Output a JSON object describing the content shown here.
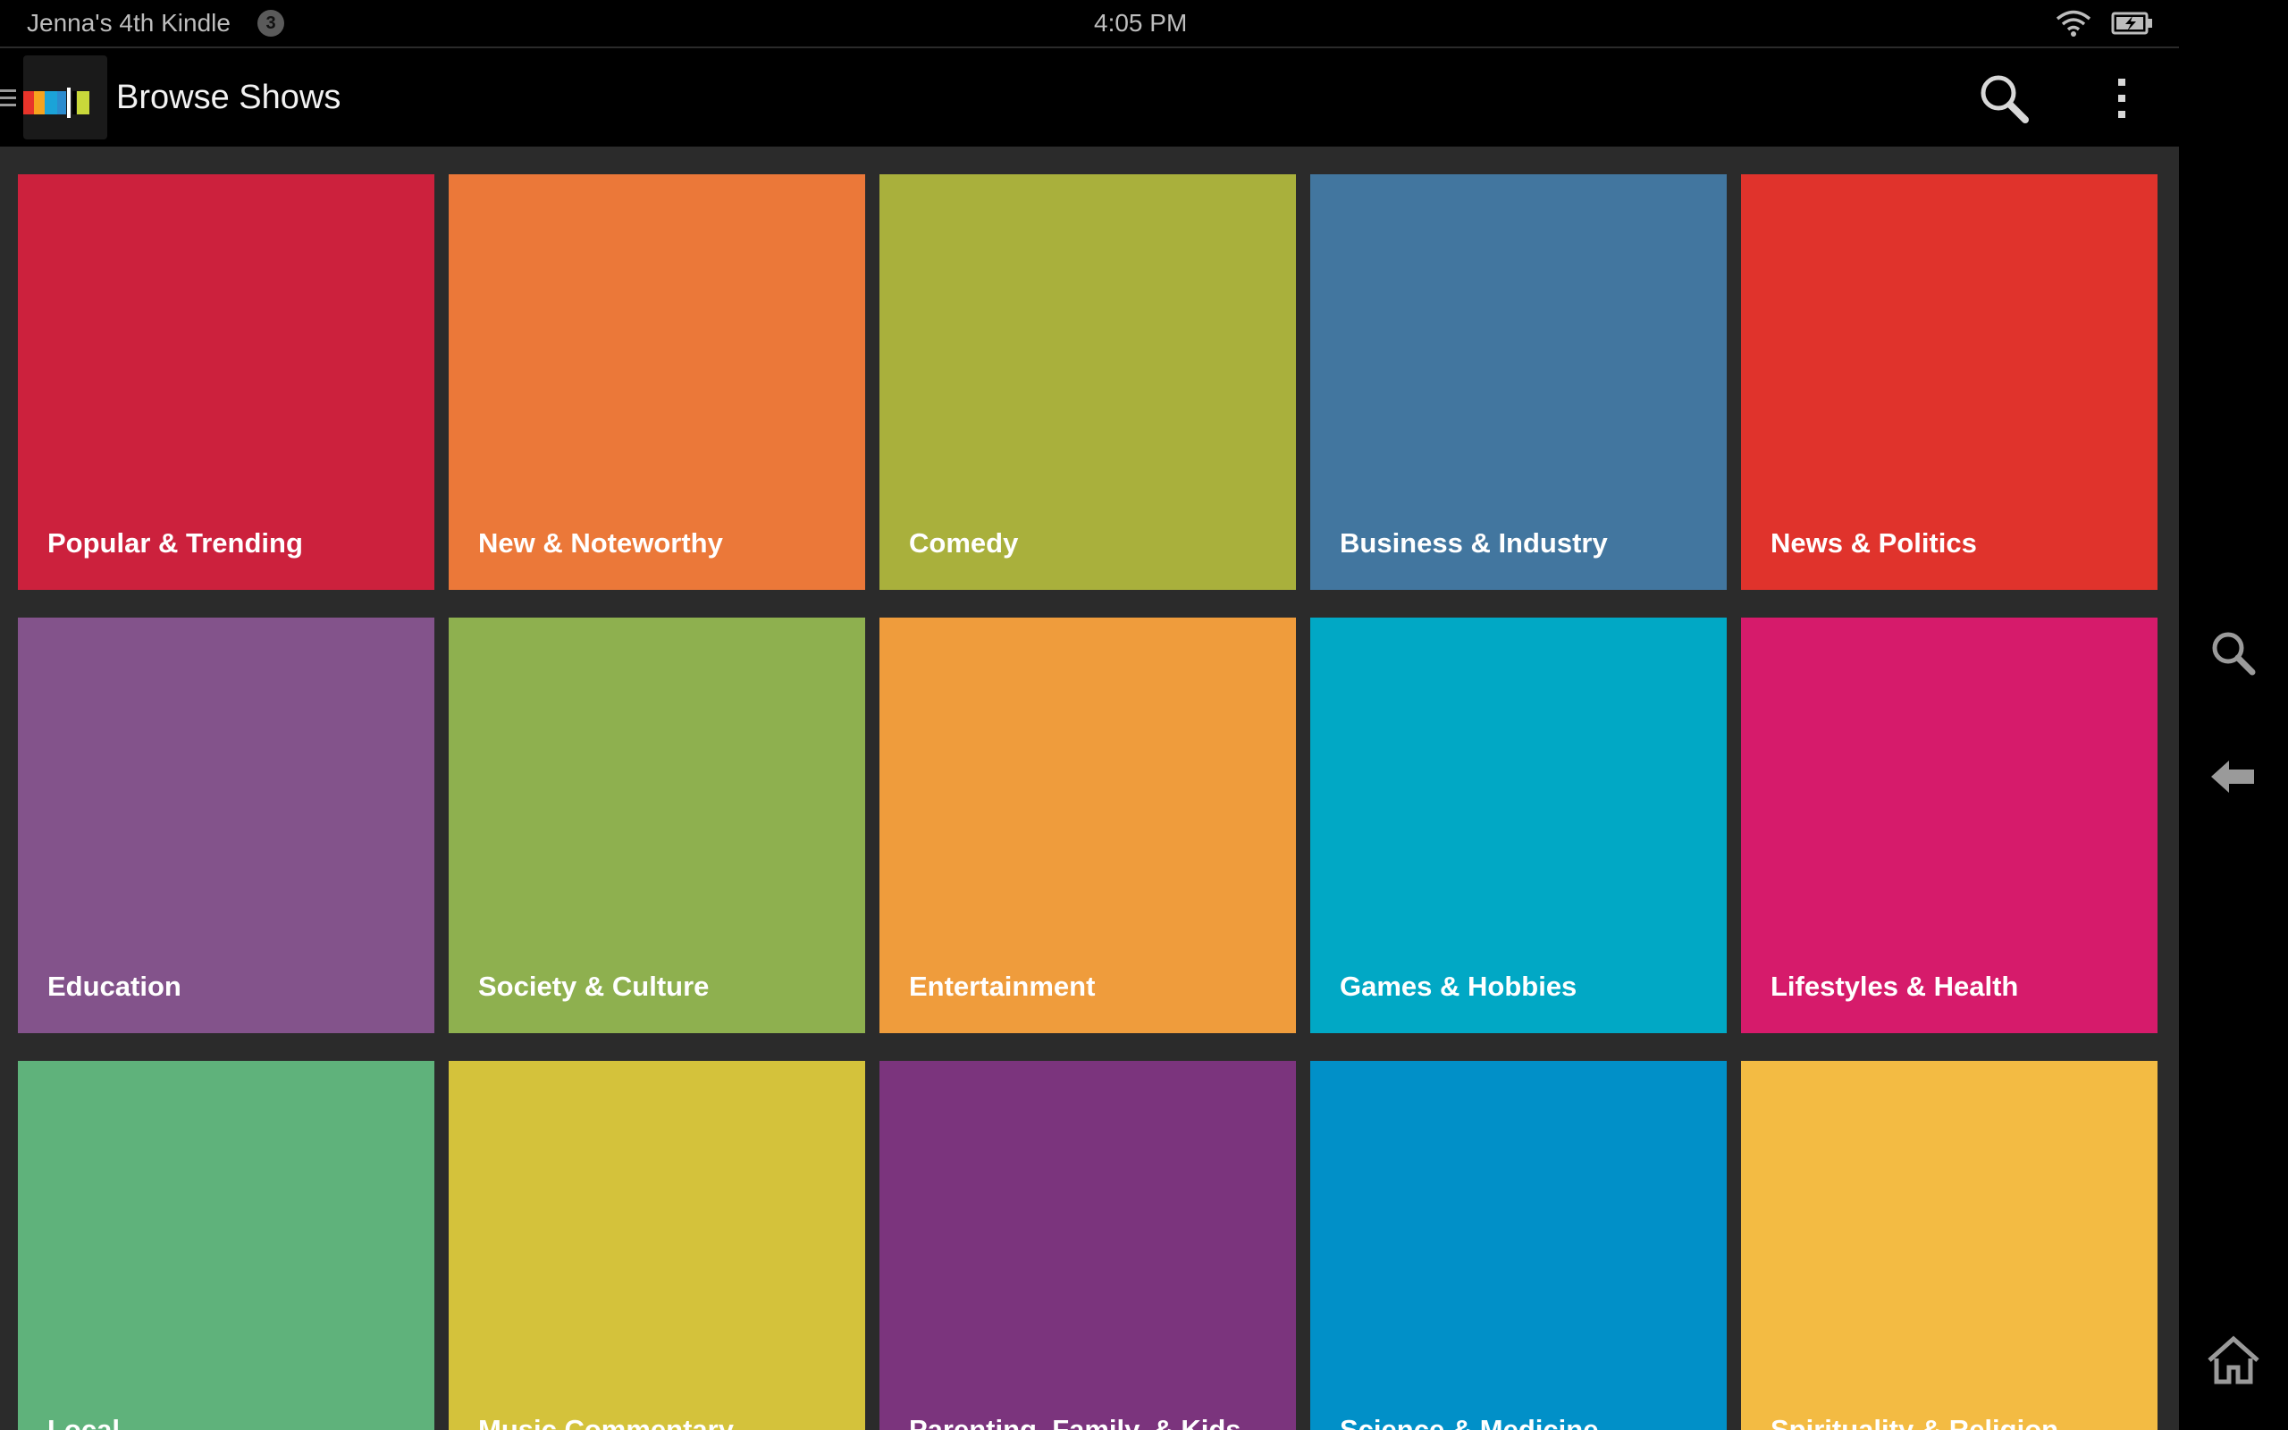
{
  "status_bar": {
    "device_name": "Jenna's 4th Kindle",
    "notification_count": "3",
    "time": "4:05 PM",
    "icons": [
      "wifi-icon",
      "battery-icon"
    ]
  },
  "action_bar": {
    "title": "Browse Shows",
    "icons": [
      "drawer-icon",
      "app-logo",
      "search-icon",
      "overflow-menu-icon"
    ]
  },
  "categories": [
    {
      "label": "Popular & Trending",
      "color": "#cc213d"
    },
    {
      "label": "New & Noteworthy",
      "color": "#eb7839"
    },
    {
      "label": "Comedy",
      "color": "#a9b03c"
    },
    {
      "label": "Business & Industry",
      "color": "#42769f"
    },
    {
      "label": "News & Politics",
      "color": "#e0332c"
    },
    {
      "label": "Education",
      "color": "#83538b"
    },
    {
      "label": "Society & Culture",
      "color": "#8eb04f"
    },
    {
      "label": "Entertainment",
      "color": "#ef9c3c"
    },
    {
      "label": "Games & Hobbies",
      "color": "#01a8c5"
    },
    {
      "label": "Lifestyles & Health",
      "color": "#d61b6b"
    },
    {
      "label": "Local",
      "color": "#5fb27b"
    },
    {
      "label": "Music Commentary",
      "color": "#d4c23b"
    },
    {
      "label": "Parenting, Family, & Kids",
      "color": "#7b347d"
    },
    {
      "label": "Science & Medicine",
      "color": "#0190c8"
    },
    {
      "label": "Spirituality & Religion",
      "color": "#f3bb43"
    }
  ],
  "nav_bar": {
    "icons": [
      "search-icon",
      "back-icon",
      "home-icon"
    ]
  }
}
